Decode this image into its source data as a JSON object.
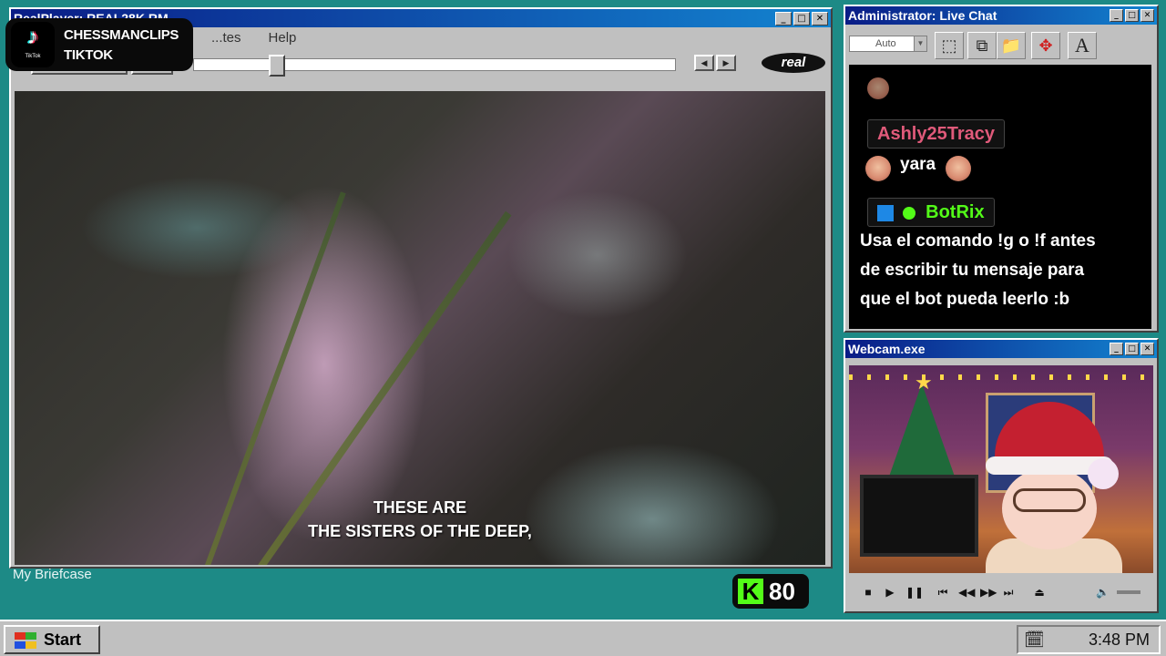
{
  "player": {
    "title": "RealPlayer: REAL28K.RM",
    "menu": [
      "...tes",
      "Help"
    ],
    "brand": "real",
    "subtitle_line1": "THESE ARE",
    "subtitle_line2": "THE SISTERS OF THE DEEP,",
    "seek_position": 0.16
  },
  "tiktok": {
    "line1": "CHESSMANCLIPS",
    "line2": "TIKTOK",
    "logo_small": "TikTok"
  },
  "desktop": {
    "icon_label": "My Briefcase"
  },
  "kick": {
    "letter": "K",
    "viewers": "80"
  },
  "chat": {
    "title": "Administrator: Live Chat",
    "combo_value": "Auto",
    "messages": [
      {
        "user": "Ashly25Tracy",
        "text": "yara",
        "user_color": "#e05a7a"
      },
      {
        "user": "BotRix",
        "text_lines": [
          "Usa el comando !g o !f antes",
          "de escribir tu mensaje para",
          "que el bot pueda leerlo :b"
        ],
        "user_color": "#53fc18"
      }
    ],
    "font_glyph": "A"
  },
  "webcam": {
    "title": "Webcam.exe"
  },
  "taskbar": {
    "start_label": "Start",
    "clock": "3:48 PM"
  },
  "colors": {
    "desktop": "#1d8a86",
    "titlebar_start": "#0a1c86",
    "titlebar_end": "#1384d0",
    "kick_green": "#53fc18"
  }
}
